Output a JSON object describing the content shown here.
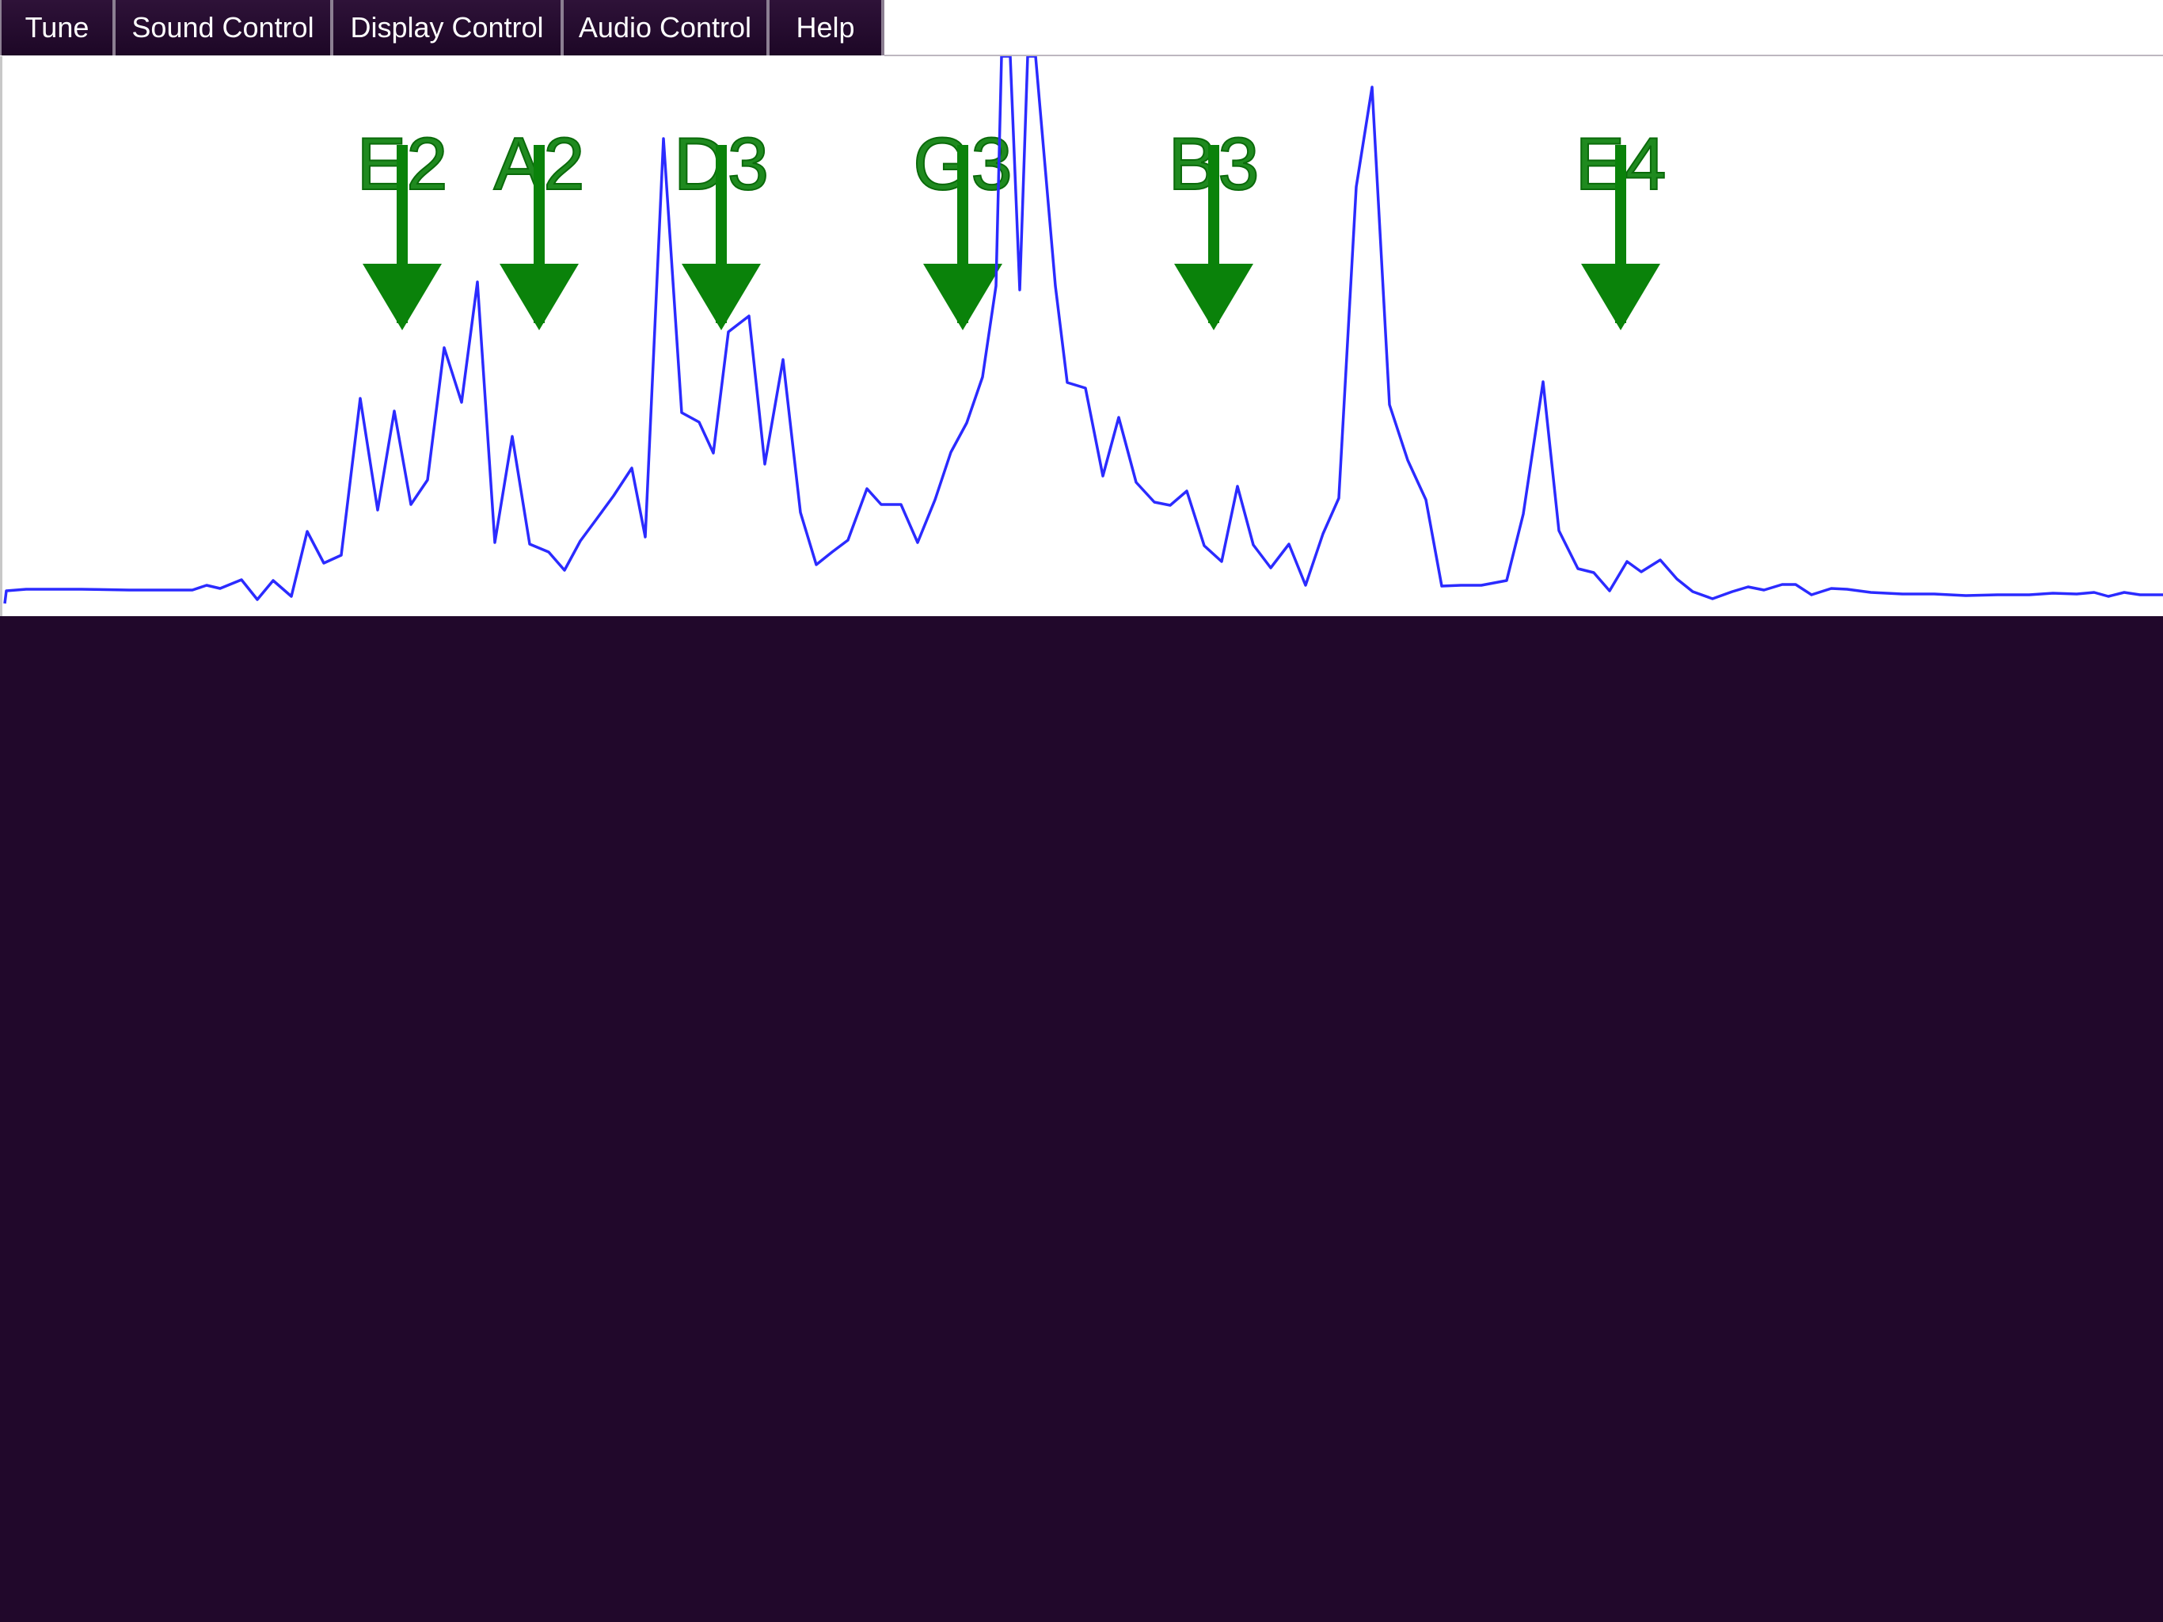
{
  "menu": {
    "tabs": [
      {
        "label": "Tune"
      },
      {
        "label": "Sound Control"
      },
      {
        "label": "Display Control"
      },
      {
        "label": "Audio Control"
      },
      {
        "label": "Help"
      }
    ]
  },
  "tuner": {
    "notes": [
      "E2",
      "A2",
      "D3",
      "G3",
      "B3",
      "E4"
    ],
    "marker_color": "#0a820a",
    "trace_color": "#2b2bff",
    "panel_color": "#ffffff",
    "background_color": "#21082b"
  }
}
